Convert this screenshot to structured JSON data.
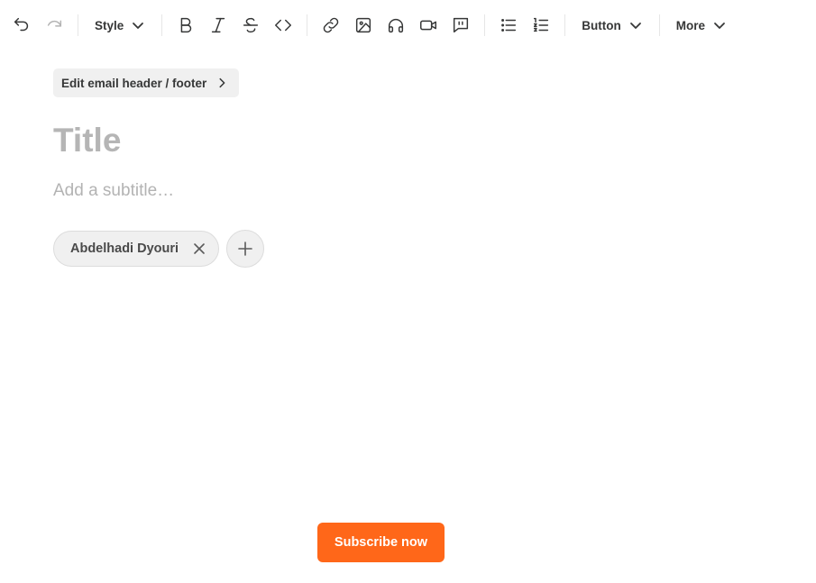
{
  "toolbar": {
    "undo_icon": "undo-icon",
    "redo_icon": "redo-icon",
    "style_label": "Style",
    "bold_icon": "bold-icon",
    "italic_icon": "italic-icon",
    "strikethrough_icon": "strikethrough-icon",
    "code_icon": "code-icon",
    "link_icon": "link-icon",
    "image_icon": "image-icon",
    "audio_icon": "headphones-icon",
    "video_icon": "video-icon",
    "quote_icon": "quote-icon",
    "bullet_list_icon": "bullet-list-icon",
    "numbered_list_icon": "numbered-list-icon",
    "button_label": "Button",
    "more_label": "More"
  },
  "editor": {
    "header_footer_label": "Edit email header / footer",
    "title_placeholder": "Title",
    "subtitle_placeholder": "Add a subtitle…",
    "authors": [
      {
        "name": "Abdelhadi Dyouri"
      }
    ],
    "subscribe_label": "Subscribe now"
  },
  "colors": {
    "accent": "#ff6719",
    "text": "#363737",
    "placeholder": "#b5b5b5",
    "chip_bg": "#f0f0f0"
  }
}
